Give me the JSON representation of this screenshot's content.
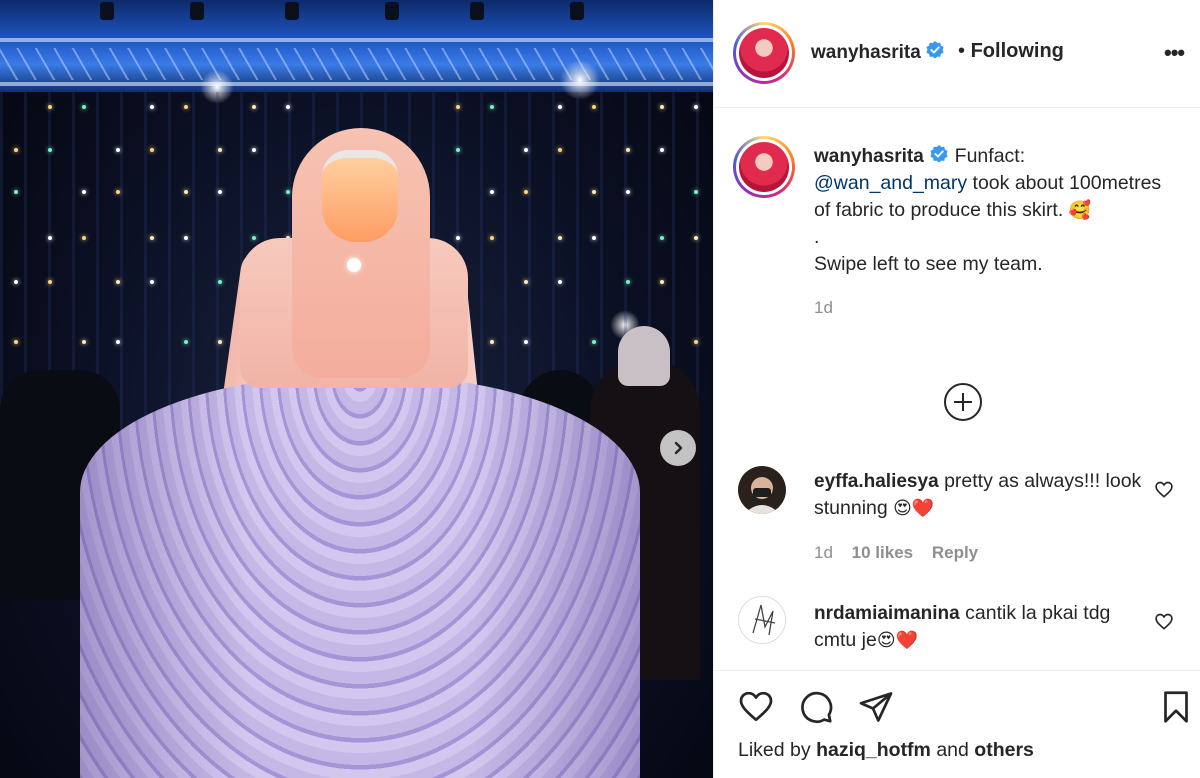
{
  "post": {
    "author": "wanyhasrita",
    "separator": "•",
    "follow_state": "Following",
    "more_label": "•••"
  },
  "caption": {
    "author": "wanyhasrita",
    "lead": "Funfact:",
    "mention": "@wan_and_mary",
    "body": "took about 100metres of fabric to produce this skirt.",
    "emoji": "🥰",
    "dot": ".",
    "line2": "Swipe left to see my team.",
    "time": "1d"
  },
  "comments": [
    {
      "user": "eyffa.haliesya",
      "text": "pretty as always!!! look stunning",
      "emoji": "😍❤️",
      "time": "1d",
      "likes": "10 likes",
      "reply": "Reply"
    },
    {
      "user": "nrdamiaimanina",
      "text": "cantik la pkai tdg cmtu je",
      "emoji": "😍❤️"
    }
  ],
  "footer": {
    "liked_prefix": "Liked by",
    "liked_user": "haziq_hotfm",
    "liked_and": "and",
    "liked_others": "others"
  },
  "icons": {
    "verified": "verified-badge-icon",
    "next": "chevron-right-icon",
    "like": "heart-icon",
    "comment": "comment-icon",
    "share": "paper-plane-icon",
    "save": "bookmark-icon",
    "load_more": "plus-circle-icon"
  },
  "colors": {
    "verified": "#3897f0",
    "mention": "#00376b",
    "muted": "#8e8e8e",
    "text": "#262626"
  }
}
